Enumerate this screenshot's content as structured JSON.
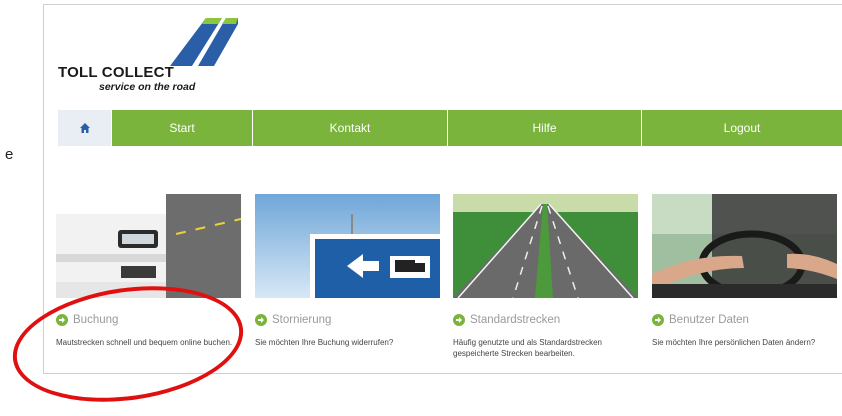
{
  "page": {
    "stray_char": "e"
  },
  "brand": {
    "name": "TOLL COLLECT",
    "tagline": "service on the road"
  },
  "nav": {
    "home_icon": "home-icon",
    "items": [
      {
        "label": "Start"
      },
      {
        "label": "Kontakt"
      },
      {
        "label": "Hilfe"
      },
      {
        "label": "Logout"
      }
    ]
  },
  "cards": [
    {
      "title": "Buchung",
      "desc": "Mautstrecken schnell und bequem online buchen.",
      "image": "truck-front-image"
    },
    {
      "title": "Stornierung",
      "desc": "Sie möchten Ihre Buchung widerrufen?",
      "image": "road-sign-image"
    },
    {
      "title": "Standardstrecken",
      "desc": "Häufig genutzte und als Standardstrecken gespeicherte Strecken bearbeiten.",
      "image": "highway-image"
    },
    {
      "title": "Benutzer Daten",
      "desc": "Sie möchten Ihre persönlichen Daten ändern?",
      "image": "driver-image"
    }
  ],
  "colors": {
    "nav_green": "#7ab43d",
    "logo_blue": "#2a5fa8",
    "highlight_red": "#e01010"
  }
}
